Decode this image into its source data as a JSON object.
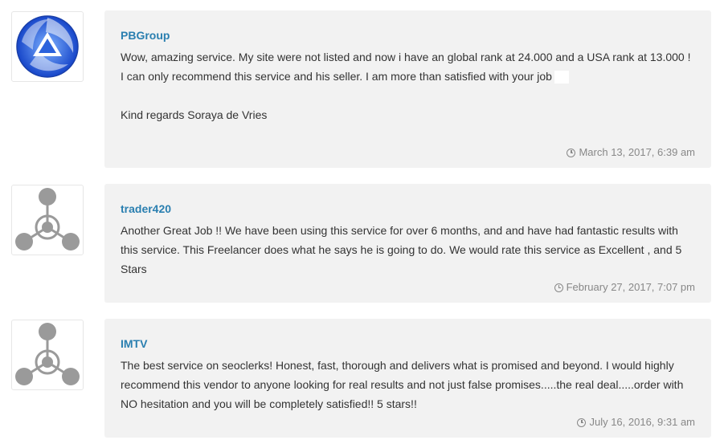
{
  "reviews": [
    {
      "avatar": "pbgroup-logo",
      "username": "PBGroup",
      "lines": [
        "Wow, amazing service. My site were not listed and now i have an global rank at 24.000 and a USA rank at 13.000 !",
        "I can only recommend this service and his seller. I am more than satisfied with your job",
        "",
        "Kind regards Soraya de Vries"
      ],
      "date": "March 13, 2017, 6:39 am",
      "date_icon": "clock-icon"
    },
    {
      "avatar": "default-avatar",
      "username": "trader420",
      "lines": [
        "Another Great Job !! We have been using this service for over 6 months, and and have had fantastic results with this service. This Freelancer does what he says he is going to do. We would rate this service as Excellent , and 5 Stars"
      ],
      "date": "February 27, 2017, 7:07 pm",
      "date_icon": "clock-icon"
    },
    {
      "avatar": "default-avatar",
      "username": "IMTV",
      "lines": [
        "The best service on seoclerks! Honest, fast, thorough and delivers what is promised and beyond. I would highly recommend this vendor to anyone looking for real results and not just false promises.....the real deal.....order with NO hesitation and you will be completely satisfied!! 5 stars!!"
      ],
      "date": "July 16, 2016, 9:31 am",
      "date_icon": "clock-icon"
    }
  ],
  "colors": {
    "username": "#2a7fb0",
    "bubble_bg": "#f2f2f2",
    "text": "#333333",
    "meta": "#888888",
    "avatar_grey": "#9a9a9a",
    "logo_blue": "#1e5bd6"
  }
}
